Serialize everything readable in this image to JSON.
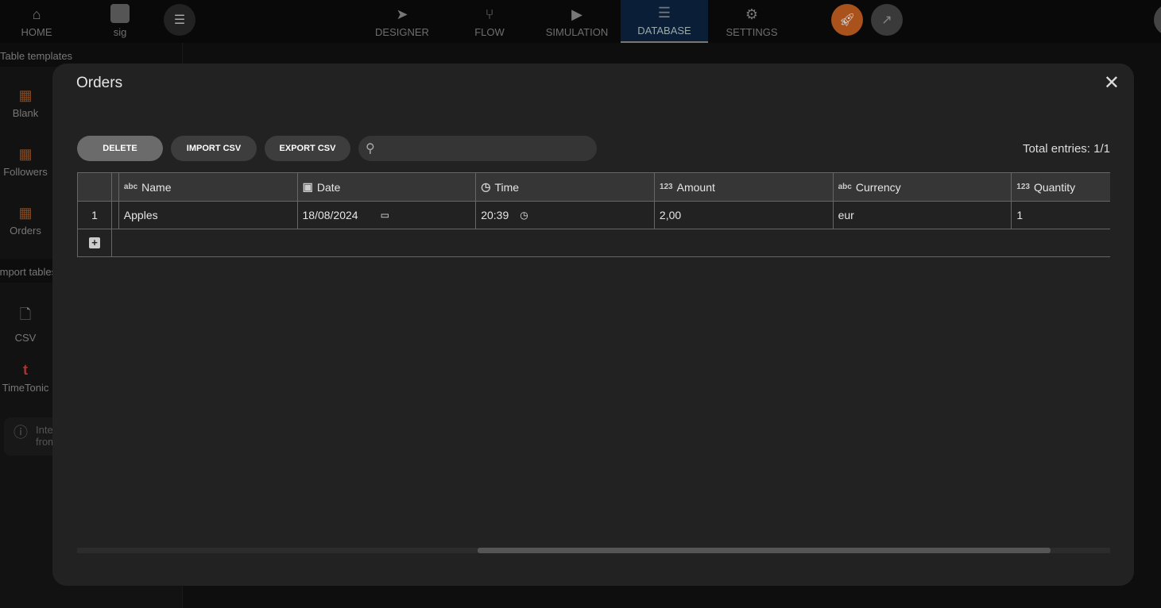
{
  "topbar": {
    "home": "HOME",
    "project": "sig",
    "tabs": [
      "DESIGNER",
      "FLOW",
      "SIMULATION",
      "DATABASE",
      "SETTINGS"
    ],
    "active_tab": "DATABASE",
    "accent": "#b85a1e"
  },
  "sidebar": {
    "section_templates": "Table templates",
    "templates": [
      "Blank",
      "Followers",
      "Orders"
    ],
    "section_import": "Import tables",
    "imports": [
      "CSV",
      "TimeTonic"
    ],
    "info": "Integrate from"
  },
  "modal": {
    "title": "Orders",
    "buttons": {
      "delete": "DELETE",
      "import": "IMPORT CSV",
      "export": "EXPORT CSV"
    },
    "search_placeholder": "",
    "total": "Total entries: 1/1",
    "columns": [
      {
        "type": "abc",
        "name": "Name"
      },
      {
        "type": "date",
        "name": "Date"
      },
      {
        "type": "time",
        "name": "Time"
      },
      {
        "type": "123",
        "name": "Amount"
      },
      {
        "type": "abc",
        "name": "Currency"
      },
      {
        "type": "123",
        "name": "Quantity"
      }
    ],
    "rows": [
      {
        "index": "1",
        "cells": [
          "Apples",
          "18/08/2024",
          "20:39",
          "2,00",
          "eur",
          "1"
        ]
      }
    ]
  }
}
